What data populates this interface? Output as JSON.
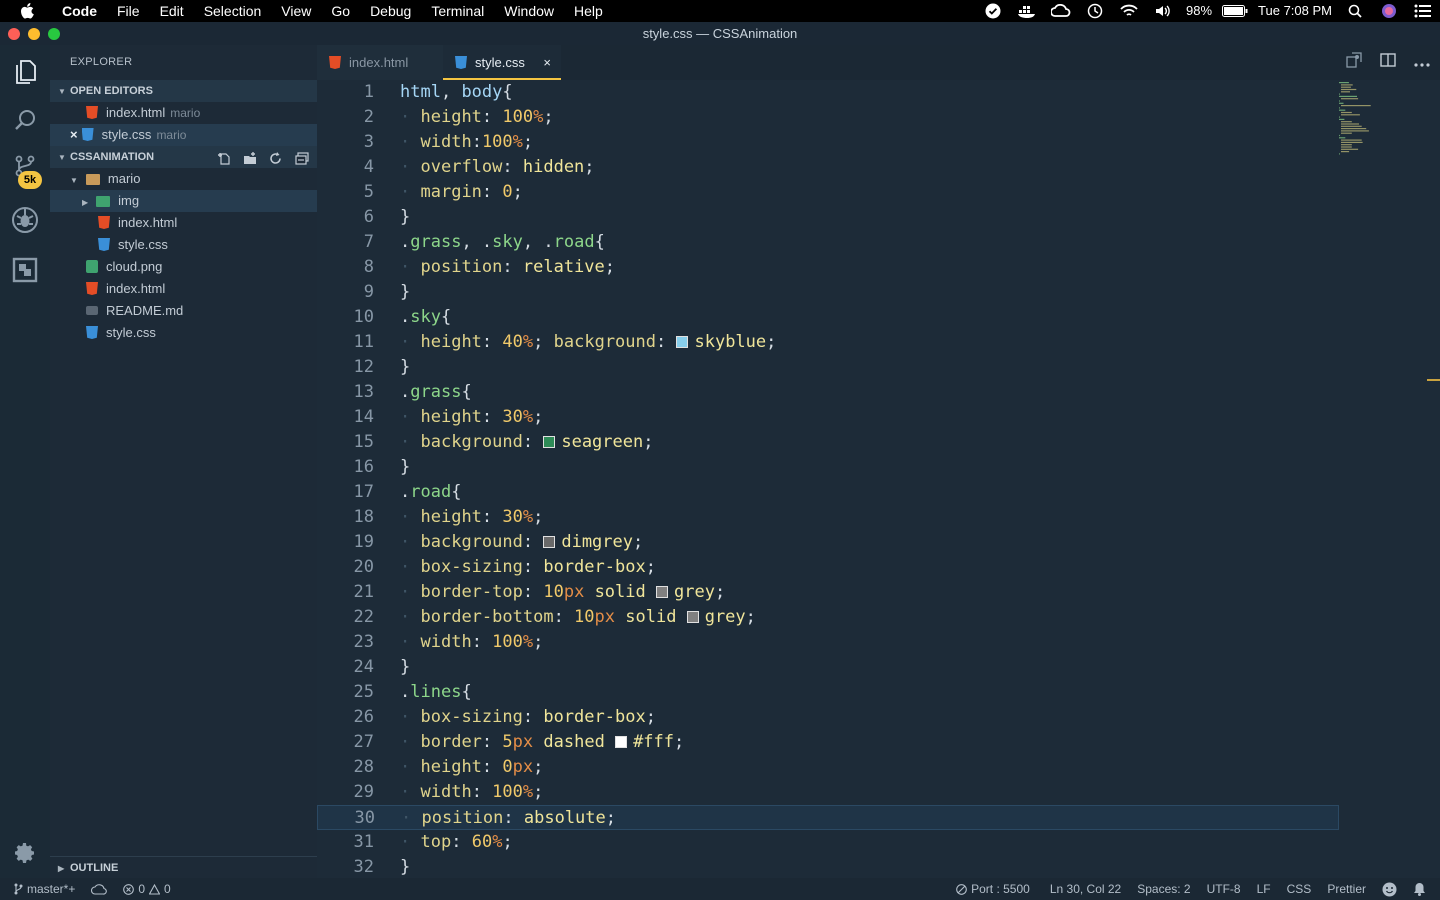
{
  "menubar": {
    "app": "Code",
    "items": [
      "File",
      "Edit",
      "Selection",
      "View",
      "Go",
      "Debug",
      "Terminal",
      "Window",
      "Help"
    ],
    "battery": "98%",
    "clock": "Tue 7:08 PM"
  },
  "window": {
    "title": "style.css — CSSAnimation"
  },
  "activity": {
    "scm_badge": "5k"
  },
  "sidebar": {
    "title": "EXPLORER",
    "open_editors_label": "OPEN EDITORS",
    "open_editors": [
      {
        "name": "index.html",
        "folder": "mario",
        "type": "html"
      },
      {
        "name": "style.css",
        "folder": "mario",
        "type": "css",
        "close": "×"
      }
    ],
    "project_label": "CSSANIMATION",
    "tree": {
      "mario": "mario",
      "img": "img",
      "mario_index": "index.html",
      "mario_style": "style.css",
      "cloud": "cloud.png",
      "index": "index.html",
      "readme": "README.md",
      "style": "style.css"
    },
    "outline_label": "OUTLINE"
  },
  "tabs": [
    {
      "label": "index.html",
      "type": "html"
    },
    {
      "label": "style.css",
      "type": "css",
      "close": "×"
    }
  ],
  "editor": {
    "current_line": 30,
    "lines": [
      "html, body{",
      "  height: 100%;",
      "  width:100%;",
      "  overflow: hidden;",
      "  margin: 0;",
      "}",
      ".grass, .sky, .road{",
      "  position: relative;",
      "}",
      ".sky{",
      "  height: 40%; background: skyblue;",
      "}",
      ".grass{",
      "  height: 30%;",
      "  background: seagreen;",
      "}",
      ".road{",
      "  height: 30%;",
      "  background: dimgrey;",
      "  box-sizing: border-box;",
      "  border-top: 10px solid grey;",
      "  border-bottom: 10px solid grey;",
      "  width: 100%;",
      "}",
      ".lines{",
      "  box-sizing: border-box;",
      "  border: 5px dashed #fff;",
      "  height: 0px;",
      "  width: 100%;",
      "  position: absolute;",
      "  top: 60%;",
      "}"
    ]
  },
  "statusbar": {
    "branch": "master*+",
    "errors": "0",
    "warnings": "0",
    "port": "Port : 5500",
    "position": "Ln 30, Col 22",
    "spaces": "Spaces: 2",
    "encoding": "UTF-8",
    "eol": "LF",
    "language": "CSS",
    "formatter": "Prettier"
  },
  "colors": {
    "accent": "#f4c542",
    "editor_bg": "#1d2b38",
    "skyblue": "#87ceeb",
    "seagreen": "#2e8b57",
    "dimgrey": "#696969",
    "grey": "#808080",
    "white": "#ffffff"
  }
}
